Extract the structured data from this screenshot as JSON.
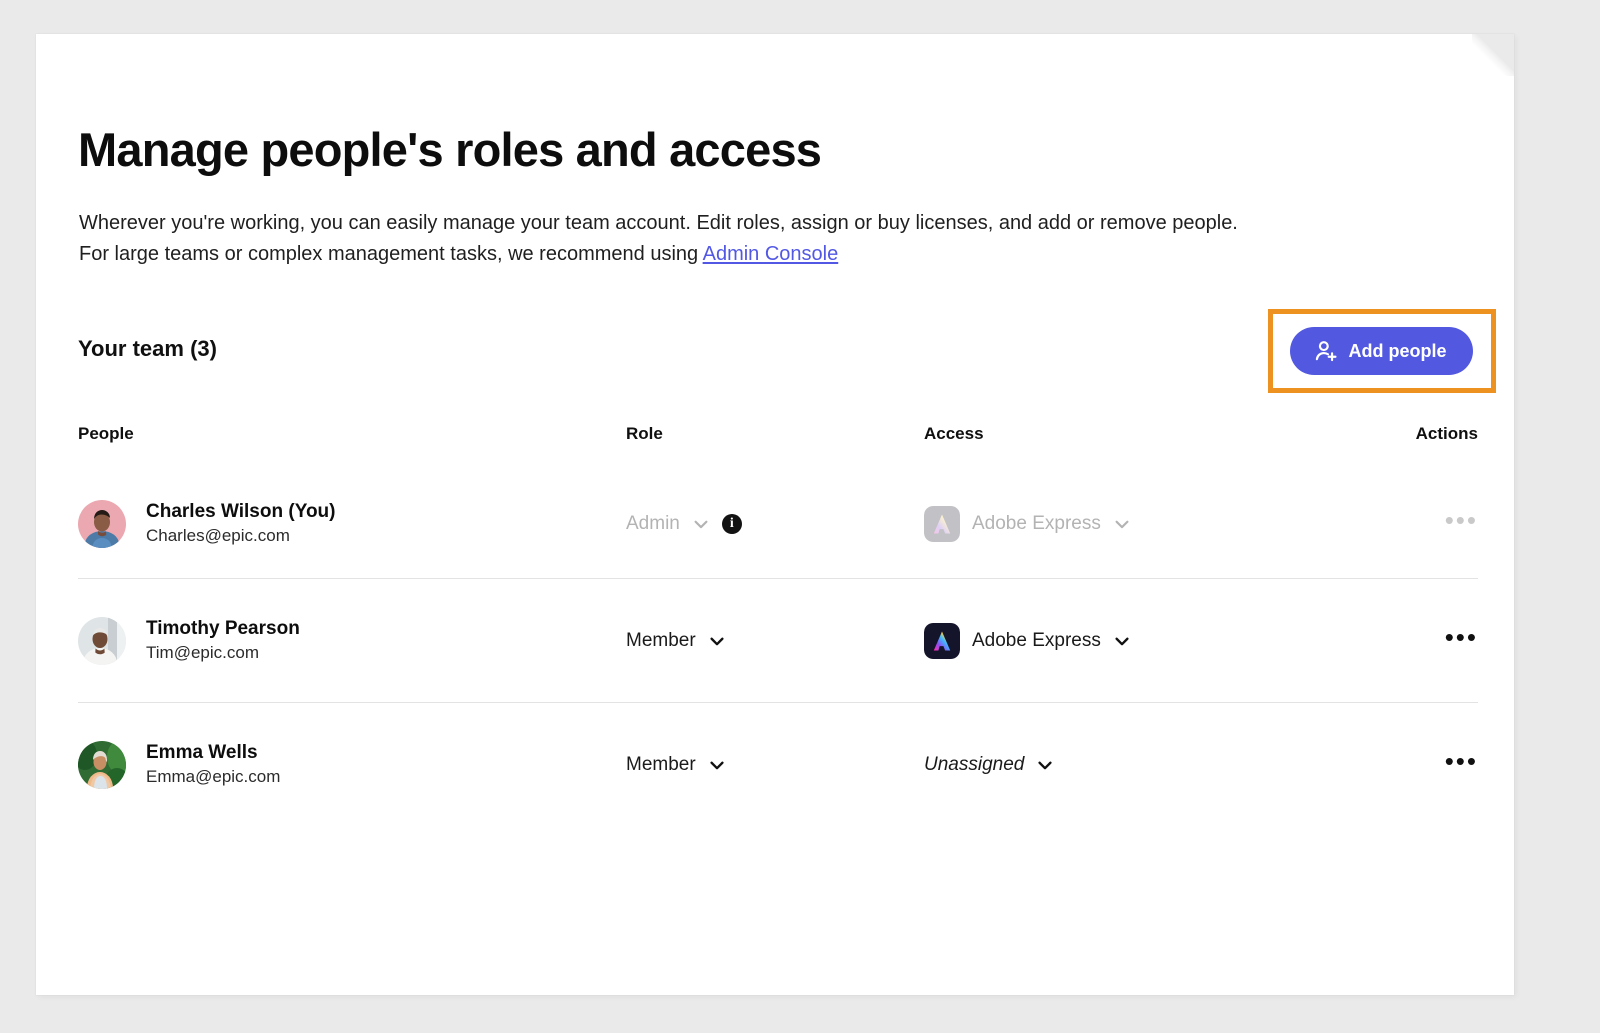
{
  "page": {
    "title": "Manage people's roles and access",
    "description_line1": "Wherever you're working, you can easily manage your team account. Edit roles, assign or buy licenses, and add or remove people.",
    "description_line2_prefix": "For large teams or complex management tasks, we recommend using ",
    "admin_console_link": "Admin Console"
  },
  "team": {
    "heading": "Your team (3)",
    "add_people_label": "Add people",
    "add_people_icon": "add-person-icon",
    "highlight_color": "#ed9121",
    "button_color": "#5259e0"
  },
  "table": {
    "columns": [
      "People",
      "Role",
      "Access",
      "Actions"
    ],
    "rows": [
      {
        "name": "Charles Wilson (You)",
        "email": "Charles@epic.com",
        "role": "Admin",
        "role_disabled": true,
        "role_info_icon": "info-icon",
        "access": "Adobe Express",
        "access_icon": "adobe-express-icon",
        "access_disabled": true,
        "access_italic": false,
        "actions_icon": "more-options-icon",
        "actions_disabled": true,
        "avatar": "avatar-charles"
      },
      {
        "name": "Timothy Pearson",
        "email": "Tim@epic.com",
        "role": "Member",
        "role_disabled": false,
        "access": "Adobe Express",
        "access_icon": "adobe-express-icon",
        "access_disabled": false,
        "access_italic": false,
        "actions_icon": "more-options-icon",
        "actions_disabled": false,
        "avatar": "avatar-timothy"
      },
      {
        "name": "Emma Wells",
        "email": "Emma@epic.com",
        "role": "Member",
        "role_disabled": false,
        "access": "Unassigned",
        "access_icon": null,
        "access_disabled": false,
        "access_italic": true,
        "actions_icon": "more-options-icon",
        "actions_disabled": false,
        "avatar": "avatar-emma"
      }
    ],
    "more_glyph": "•••",
    "info_glyph": "i"
  }
}
